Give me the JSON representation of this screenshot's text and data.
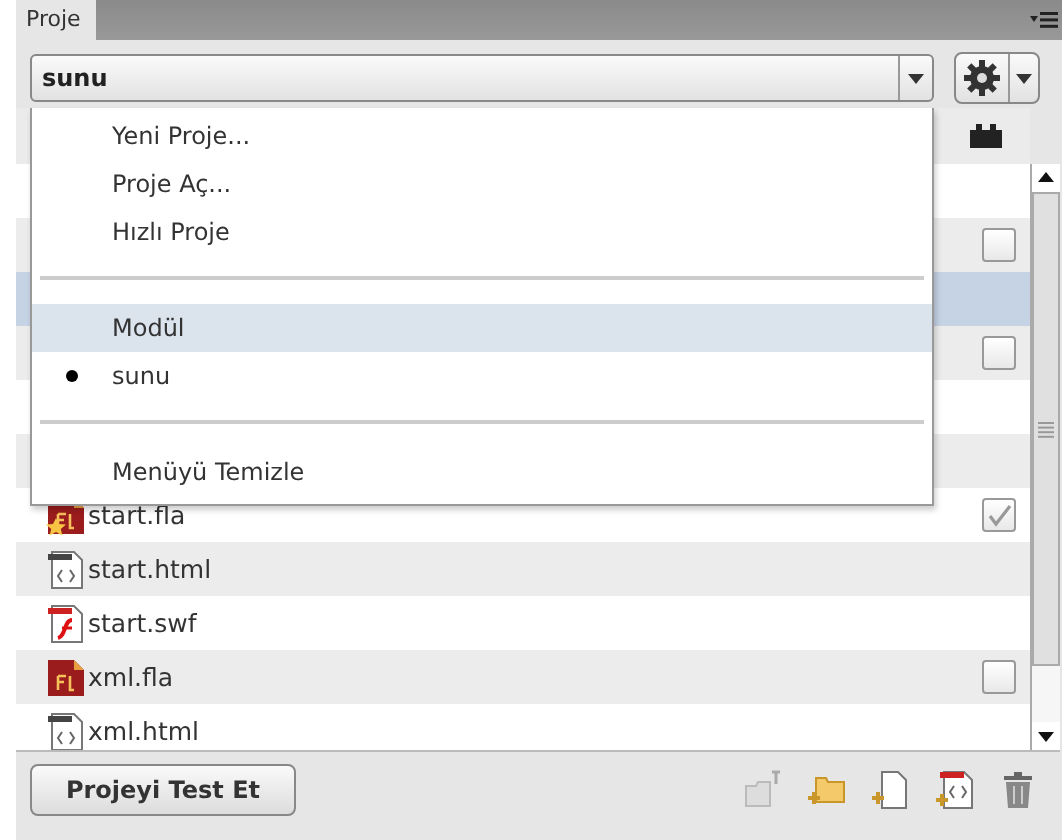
{
  "panel": {
    "tab": "Proje",
    "selector": {
      "value": "sunu"
    }
  },
  "menu": [
    {
      "kind": "item",
      "label": "Yeni Proje...",
      "highlighted": false
    },
    {
      "kind": "item",
      "label": "Proje Aç...",
      "highlighted": false
    },
    {
      "kind": "item",
      "label": "Hızlı Proje",
      "highlighted": false
    },
    {
      "kind": "separator"
    },
    {
      "kind": "item",
      "label": "Modül",
      "highlighted": true
    },
    {
      "kind": "radio",
      "label": "sunu",
      "highlighted": false,
      "checked": true
    },
    {
      "kind": "separator"
    },
    {
      "kind": "item",
      "label": "Menüyü Temizle",
      "highlighted": false
    }
  ],
  "rows": [
    {
      "selected": false
    },
    {
      "selected": false,
      "checked": false
    },
    {
      "selected": true
    },
    {
      "selected": false,
      "checked": false
    },
    {
      "selected": false
    },
    {
      "selected": false
    },
    {
      "selected": false,
      "name": "start.fla",
      "kind": "fla-main",
      "checked": true
    },
    {
      "selected": false,
      "name": "start.html",
      "kind": "html"
    },
    {
      "selected": false,
      "name": "start.swf",
      "kind": "swf"
    },
    {
      "selected": false,
      "name": "xml.fla",
      "kind": "fla",
      "checked": false
    },
    {
      "selected": false,
      "name": "xml.html",
      "kind": "html"
    }
  ],
  "footer": {
    "button": "Projeyi Test Et"
  }
}
